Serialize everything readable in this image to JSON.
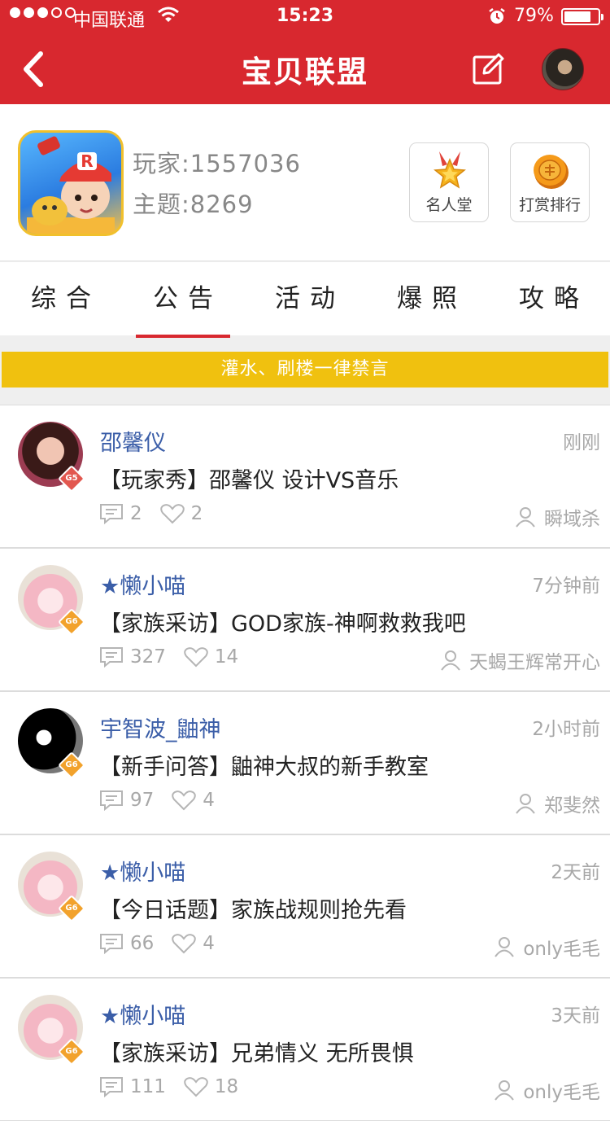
{
  "status_bar": {
    "carrier": "中国联通",
    "time": "15:23",
    "battery_percent": "79%",
    "battery_level": 0.79,
    "signal_bars_filled": 3,
    "signal_bars_total": 5
  },
  "nav": {
    "title": "宝贝联盟",
    "back_icon": "chevron-left-icon",
    "edit_icon": "edit-icon"
  },
  "game": {
    "players": "玩家:1557036",
    "topics": "主题:8269",
    "fame_label": "名人堂",
    "reward_label": "打赏排行"
  },
  "tabs": [
    {
      "label": "综合",
      "active": false
    },
    {
      "label": "公告",
      "active": true
    },
    {
      "label": "活动",
      "active": false
    },
    {
      "label": "爆照",
      "active": false
    },
    {
      "label": "攻略",
      "active": false
    }
  ],
  "notice": "灌水、刷楼一律禁言",
  "posts": [
    {
      "user": "邵馨仪",
      "level": "G5",
      "time": "刚刚",
      "title": "【玩家秀】邵馨仪 设计VS音乐",
      "comments": "2",
      "likes": "2",
      "author": "瞬域杀"
    },
    {
      "user": "★懒小喵",
      "level": "G6",
      "time": "7分钟前",
      "title": "【家族采访】GOD家族-神啊救救我吧",
      "comments": "327",
      "likes": "14",
      "author": "天蝎王辉常开心"
    },
    {
      "user": "宇智波_鼬神",
      "level": "G6",
      "time": "2小时前",
      "title": "【新手问答】鼬神大叔的新手教室",
      "comments": "97",
      "likes": "4",
      "author": "郑斐然"
    },
    {
      "user": "★懒小喵",
      "level": "G6",
      "time": "2天前",
      "title": "【今日话题】家族战规则抢先看",
      "comments": "66",
      "likes": "4",
      "author": "only毛毛"
    },
    {
      "user": "★懒小喵",
      "level": "G6",
      "time": "3天前",
      "title": "【家族采访】兄弟情义 无所畏惧",
      "comments": "111",
      "likes": "18",
      "author": "only毛毛"
    }
  ],
  "colors": {
    "brand_red": "#d8282f",
    "notice_yellow": "#f0c10f",
    "username_blue": "#3b5ea8"
  }
}
